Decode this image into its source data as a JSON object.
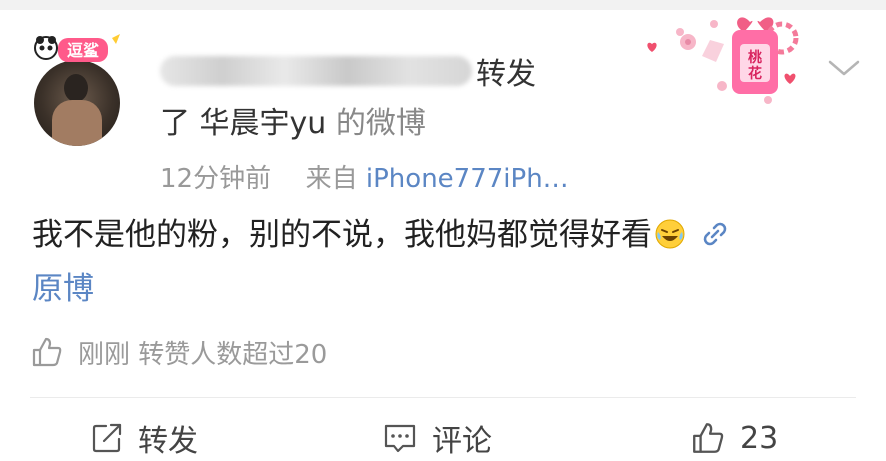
{
  "post": {
    "avatar_badge_text": "逗鲨",
    "repost_word": "转发",
    "line2_prefix": "了",
    "original_author": "华晨宇yu",
    "line2_suffix": "的微博",
    "time": "12分钟前",
    "source_prefix": "来自",
    "source": "iPhone777iPh…",
    "decoration_text": "桃花",
    "content": "我不是他的粉，别的不说，我他妈都觉得好看",
    "original_link": "原博",
    "like_note": "刚刚 转赞人数超过20"
  },
  "actions": {
    "repost_label": "转发",
    "comment_label": "评论",
    "like_count": "23"
  },
  "colors": {
    "link": "#5b86c4",
    "meta": "#999999",
    "text": "#222222"
  }
}
